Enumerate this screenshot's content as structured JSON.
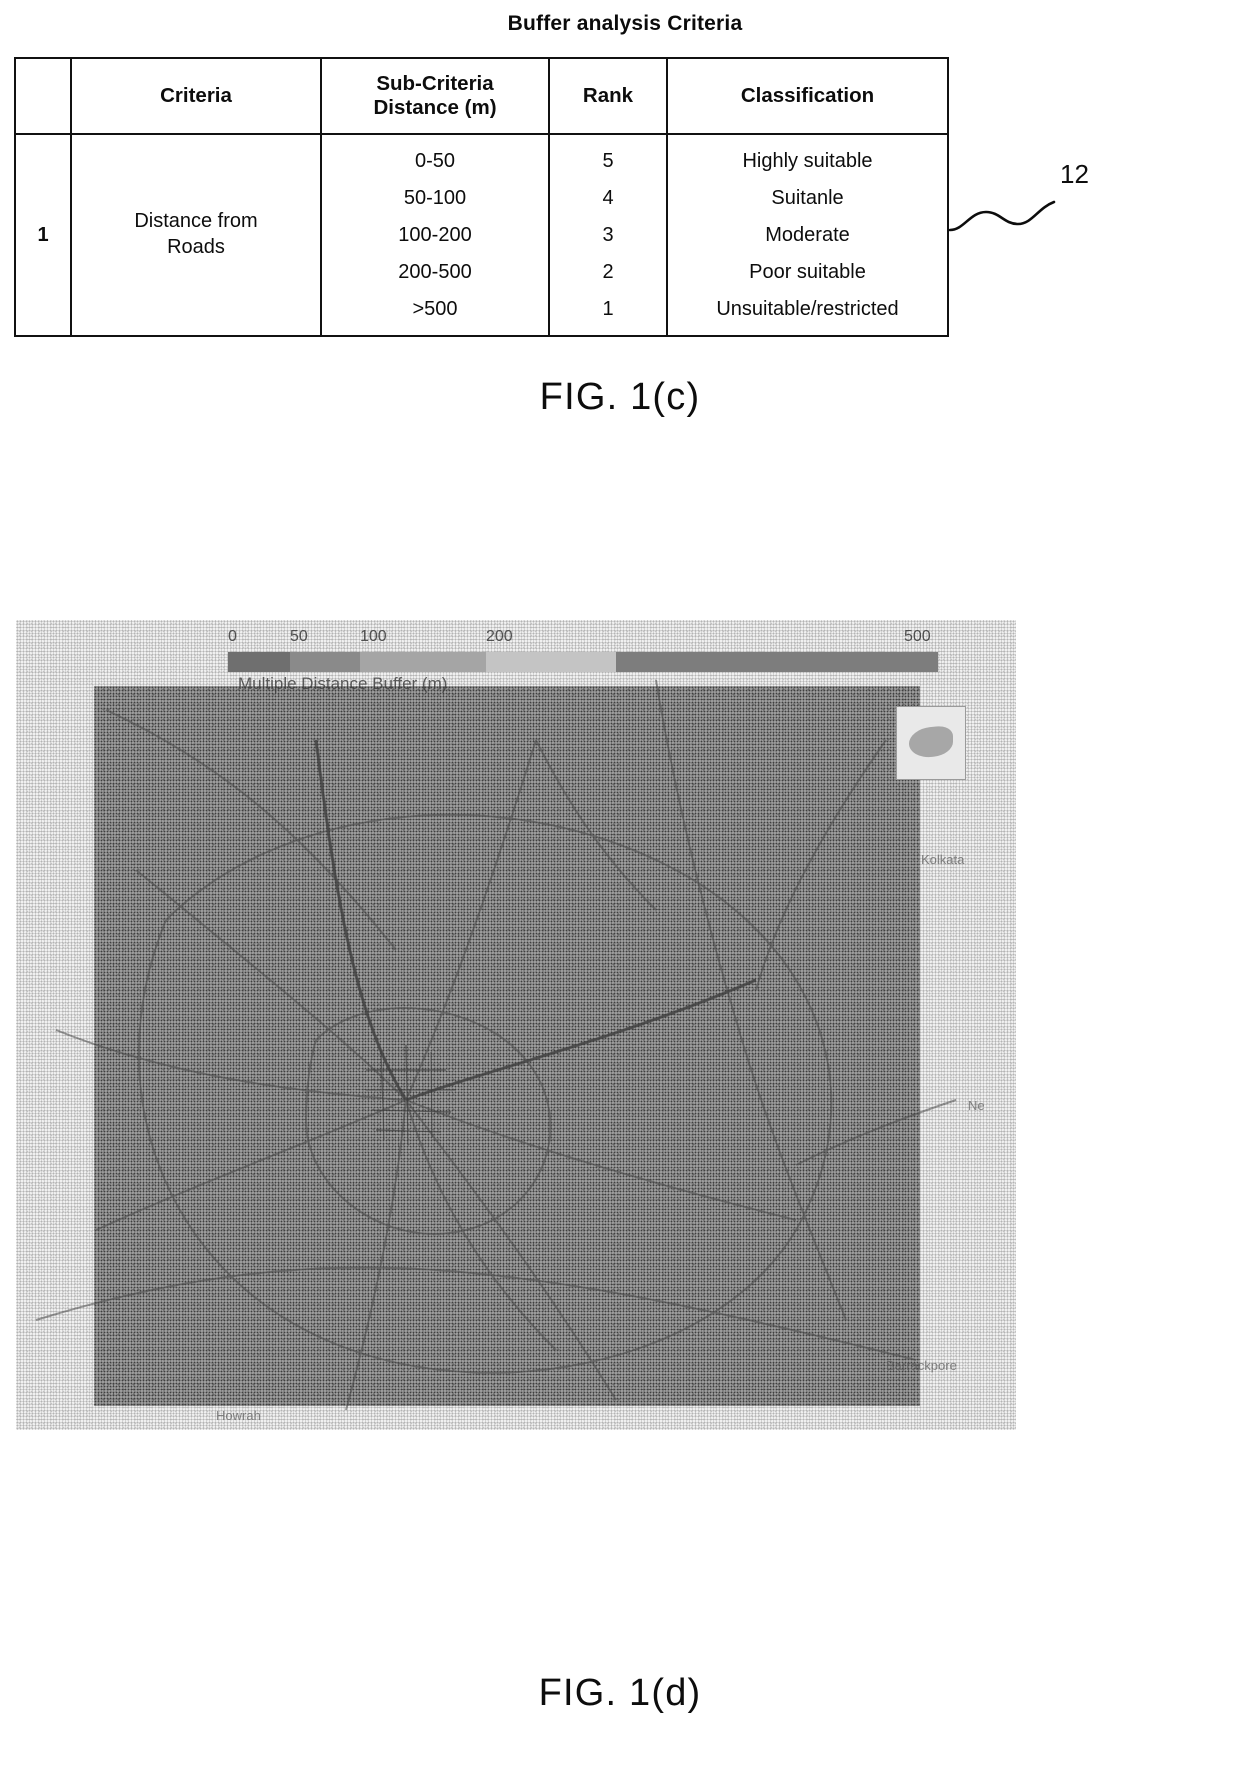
{
  "figure_1c": {
    "table_title": "Buffer analysis Criteria",
    "reference_numeral": "12",
    "caption": "FIG. 1(c)",
    "table": {
      "headers": {
        "index": "",
        "criteria": "Criteria",
        "sub_criteria_line1": "Sub-Criteria",
        "sub_criteria_line2": "Distance (m)",
        "rank": "Rank",
        "classification": "Classification"
      },
      "rows": [
        {
          "index": "1",
          "criteria_line1": "Distance from",
          "criteria_line2": "Roads",
          "sub_rows": [
            {
              "distance": "0-50",
              "rank": "5",
              "classification": "Highly suitable"
            },
            {
              "distance": "50-100",
              "rank": "4",
              "classification": "Suitanle"
            },
            {
              "distance": "100-200",
              "rank": "3",
              "classification": "Moderate"
            },
            {
              "distance": "200-500",
              "rank": "2",
              "classification": "Poor suitable"
            },
            {
              "distance": ">500",
              "rank": "1",
              "classification": "Unsuitable/restricted"
            }
          ]
        }
      ]
    }
  },
  "figure_1d": {
    "caption": "FIG. 1(d)",
    "map": {
      "legend_caption": "Multiple Distance Buffer (m)",
      "legend_ticks": [
        "0",
        "50",
        "100",
        "200",
        "500"
      ],
      "legend_classes": [
        {
          "label": "0-50",
          "color": "#6f6f6f"
        },
        {
          "label": "50-100",
          "color": "#8a8a8a"
        },
        {
          "label": "100-200",
          "color": "#a5a5a5"
        },
        {
          "label": "200-500",
          "color": "#bdbdbd"
        },
        {
          "label": ">500",
          "color": "#d2d2d2"
        }
      ],
      "place_labels": [
        "Kolkata",
        "Howrah",
        "Barrackpore",
        "Ne"
      ]
    }
  }
}
